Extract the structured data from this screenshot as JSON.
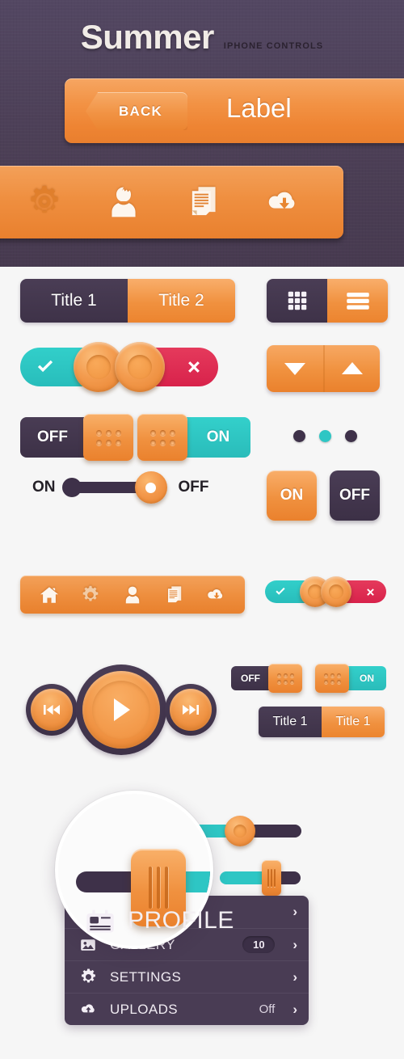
{
  "hero": {
    "title": "Summer",
    "subtitle": "IPHONE CONTROLS",
    "navbar": {
      "back_label": "BACK",
      "label": "Label"
    },
    "toolbar_icons": [
      "gear-icon",
      "user-icon",
      "document-icon",
      "cloud-download-icon"
    ]
  },
  "segmented_large": {
    "items": [
      {
        "label": "Title 1",
        "state": "inactive"
      },
      {
        "label": "Title 2",
        "state": "active"
      }
    ]
  },
  "view_toggle": {
    "items": [
      {
        "icon": "grid-view-icon",
        "state": "inactive"
      },
      {
        "icon": "list-view-icon",
        "state": "active"
      }
    ]
  },
  "pill_toggles_large": [
    {
      "icon": "check-icon",
      "state": "on",
      "color": "#2ec6c4"
    },
    {
      "icon": "cross-icon",
      "state": "off",
      "color": "#dc2a4f"
    }
  ],
  "arrow_buttons": [
    {
      "icon": "triangle-down-icon"
    },
    {
      "icon": "triangle-up-icon"
    }
  ],
  "grip_switches": [
    {
      "label": "OFF",
      "state": "off"
    },
    {
      "label": "ON",
      "state": "on"
    }
  ],
  "dot_indicator": {
    "count": 3,
    "active_index": 1,
    "active_color": "#2ec6c4",
    "inactive_color": "#3e3149"
  },
  "slider_toggle": {
    "left_label": "ON",
    "right_label": "OFF",
    "state": "off"
  },
  "square_buttons": [
    {
      "label": "ON",
      "style": "orange"
    },
    {
      "label": "OFF",
      "style": "dark"
    }
  ],
  "toolbar_small": {
    "icons": [
      "home-icon",
      "gear-icon",
      "user-icon",
      "document-icon",
      "cloud-download-icon"
    ]
  },
  "pill_toggles_small": [
    {
      "icon": "check-icon",
      "state": "on"
    },
    {
      "icon": "cross-icon",
      "state": "off"
    }
  ],
  "grip_switches_small": [
    {
      "label": "OFF",
      "state": "off"
    },
    {
      "label": "ON",
      "state": "on"
    }
  ],
  "segmented_small": {
    "items": [
      {
        "label": "Title 1",
        "state": "inactive"
      },
      {
        "label": "Title 1",
        "state": "active"
      }
    ]
  },
  "player": {
    "prev": "previous-track-icon",
    "play": "play-icon",
    "next": "next-track-icon"
  },
  "sliders": [
    {
      "knob": "rect",
      "value_pct": 46
    },
    {
      "knob": "circle",
      "value_pct": 58
    },
    {
      "knob": "rect-small",
      "value_pct": 72
    }
  ],
  "magnifier": {
    "icon": "profile-card-icon",
    "label": "PROFILE"
  },
  "menu": {
    "items": [
      {
        "icon": "profile-card-icon",
        "label": "PROFILE",
        "value": "",
        "badge": "",
        "chevron": "›"
      },
      {
        "icon": "gallery-icon",
        "label": "GALLERY",
        "value": "",
        "badge": "10",
        "chevron": "›"
      },
      {
        "icon": "gear-icon",
        "label": "SETTINGS",
        "value": "",
        "badge": "",
        "chevron": "›"
      },
      {
        "icon": "cloud-upload-icon",
        "label": "UPLOADS",
        "value": "Off",
        "badge": "",
        "chevron": "›"
      }
    ]
  },
  "colors": {
    "purple_bg": "#4c3f56",
    "orange": "#ee8c3a",
    "teal": "#2ec6c4",
    "crimson": "#dc2a4f",
    "dark_purple": "#3e3149",
    "light_bg": "#f6f6f6"
  }
}
